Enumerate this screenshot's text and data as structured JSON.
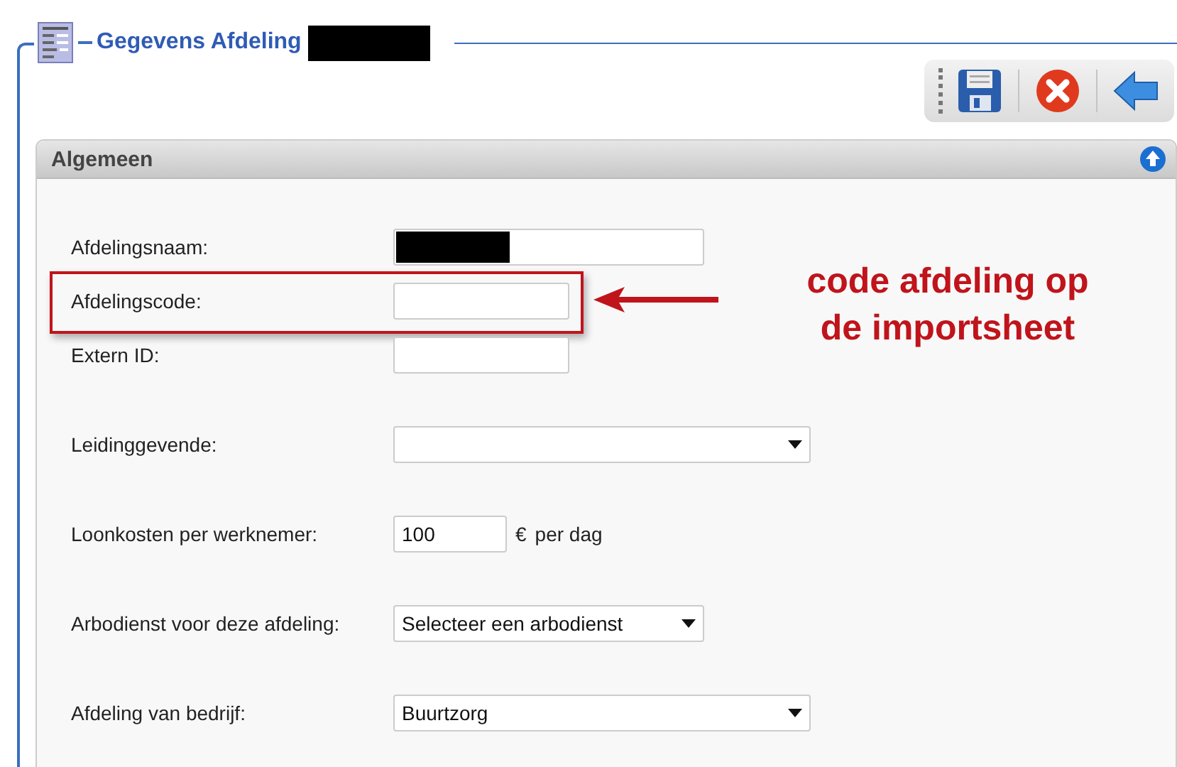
{
  "window": {
    "title": "Gegevens Afdeling"
  },
  "panel": {
    "title": "Algemeen"
  },
  "groups": [
    [
      {
        "label": "Afdelingsnaam:",
        "kind": "text",
        "redacted": true,
        "highlighted": false
      },
      {
        "label": "Afdelingscode:",
        "kind": "text",
        "highlighted": true
      },
      {
        "label": "Extern ID:",
        "kind": "text",
        "highlighted": false
      }
    ],
    [
      {
        "label": "Leidinggevende:",
        "kind": "select",
        "highlighted": false
      }
    ],
    [
      {
        "label": "Loonkosten per werknemer:",
        "kind": "text",
        "value": "100",
        "suffix": "€",
        "suffix2": "per dag",
        "highlighted": false
      }
    ],
    [
      {
        "label": "Arbodienst voor deze afdeling:",
        "kind": "select",
        "value": "Selecteer een arbodienst",
        "highlighted": false
      }
    ],
    [
      {
        "label": "Afdeling van bedrijf:",
        "kind": "select",
        "value": "Buurtzorg",
        "highlighted": false
      }
    ]
  ],
  "annotation": {
    "text": "code afdeling op de importsheet"
  }
}
